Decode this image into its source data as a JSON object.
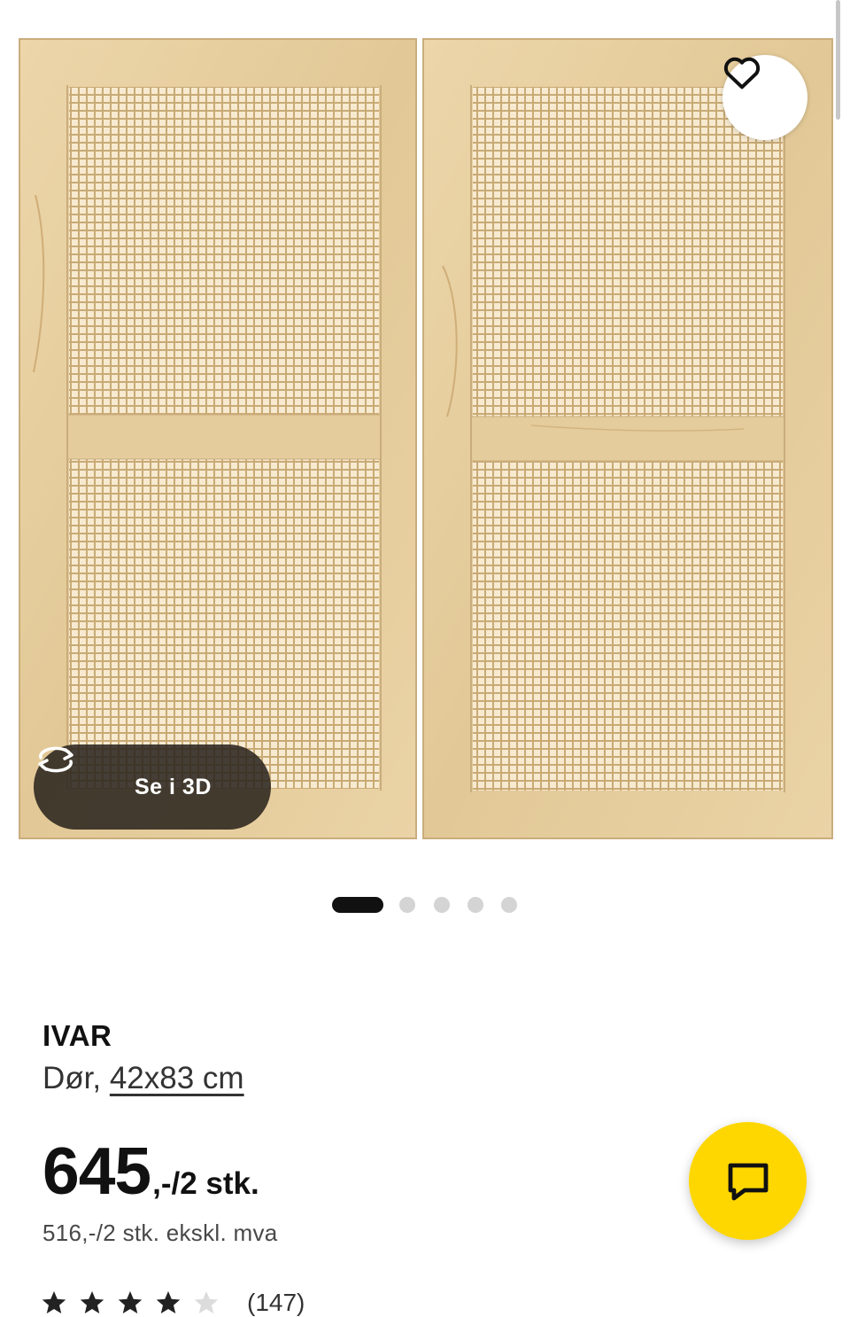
{
  "gallery": {
    "view3d_label": "Se i 3D",
    "slide_count": 5,
    "active_slide": 1,
    "icons": {
      "favorite": "heart-icon",
      "view3d": "rotate-3d-icon"
    }
  },
  "product": {
    "name": "IVAR",
    "type": "Dør,",
    "size": "42x83 cm",
    "price_whole": "645",
    "price_suffix": ",-/2 stk.",
    "price_excl_vat": "516,-/2 stk. ekskl. mva",
    "rating": {
      "value": 4,
      "max": 5,
      "count": "(147)"
    }
  },
  "chat": {
    "icon": "chat-bubble-icon",
    "color": "#ffd700"
  },
  "colors": {
    "wood": "#e8d2a5",
    "cane": "#f3e4c5",
    "dark_button": "#28221c"
  }
}
